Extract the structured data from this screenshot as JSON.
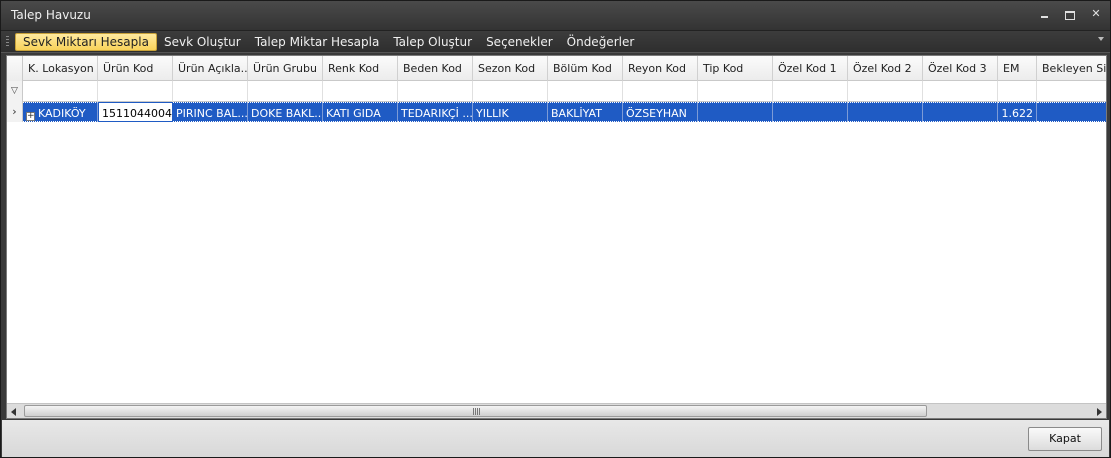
{
  "window": {
    "title": "Talep Havuzu"
  },
  "window_controls": {
    "minimize_icon": "minimize-icon",
    "maximize_icon": "maximize-icon",
    "close_icon": "close-icon"
  },
  "menu": {
    "items": [
      {
        "label": "Sevk Miktarı Hesapla",
        "active": true
      },
      {
        "label": "Sevk Oluştur",
        "active": false
      },
      {
        "label": "Talep Miktar Hesapla",
        "active": false
      },
      {
        "label": "Talep Oluştur",
        "active": false
      },
      {
        "label": "Seçenekler",
        "active": false
      },
      {
        "label": "Öndeğerler",
        "active": false
      }
    ]
  },
  "grid": {
    "columns": [
      "K. Lokasyon",
      "Ürün Kod",
      "Ürün Açıkla...",
      "Ürün Grubu",
      "Renk Kod",
      "Beden Kod",
      "Sezon Kod",
      "Bölüm Kod",
      "Reyon Kod",
      "Tip Kod",
      "Özel Kod 1",
      "Özel Kod 2",
      "Özel Kod 3",
      "EM",
      "Bekleyen Sipa"
    ],
    "rows": [
      {
        "cells": [
          "KADIKÖY",
          "1511044004",
          "PIRINC BAL...",
          "DOKE BAKL...",
          "KATI GIDA",
          "TEDARIKÇİ ...",
          "YILLIK",
          "BAKLİYAT",
          "ÖZSEYHAN",
          "",
          "",
          "",
          "",
          "1.622",
          ""
        ]
      }
    ],
    "selection_color": "#1f5bc4"
  },
  "footer": {
    "close_label": "Kapat"
  }
}
